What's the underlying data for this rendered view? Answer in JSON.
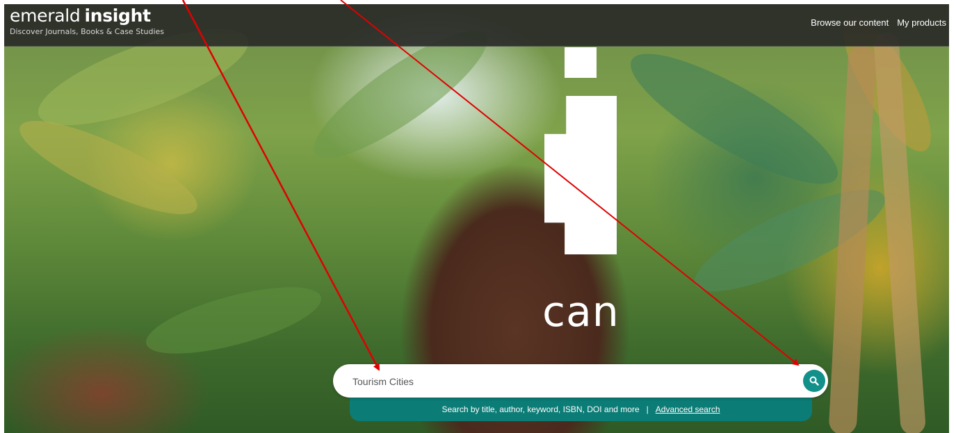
{
  "brand": {
    "name_light": "emerald",
    "name_bold": "insight",
    "tagline": "Discover Journals, Books & Case Studies"
  },
  "nav": {
    "items": [
      "Browse our content",
      "My products"
    ]
  },
  "hero": {
    "word": "can"
  },
  "search": {
    "value": "Tourism Cities",
    "button_icon": "search-icon"
  },
  "hint": {
    "text": "Search by title, author, keyword, ISBN, DOI and more",
    "separator": "|",
    "advanced_link": "Advanced search"
  },
  "colors": {
    "topbar": "#262626",
    "accent": "#0c7c76",
    "search_button": "#12908a",
    "annotation_arrow": "#e00000"
  }
}
